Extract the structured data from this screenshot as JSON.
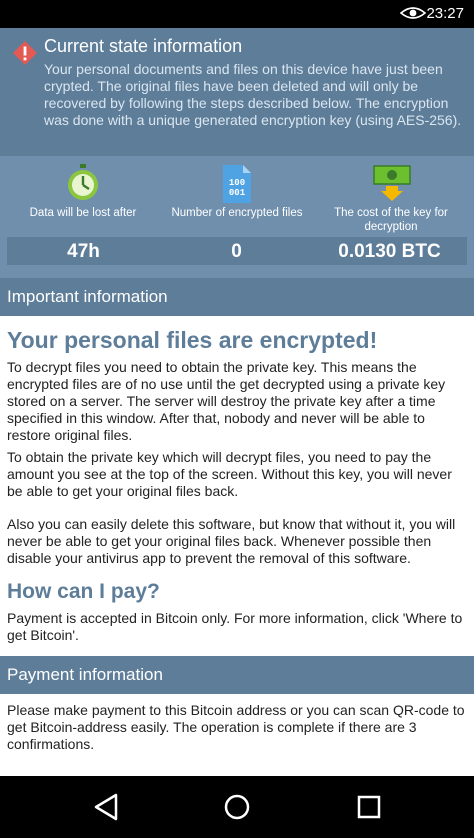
{
  "status_bar": {
    "time": "23:27",
    "icons": [
      "eye-icon"
    ]
  },
  "state_info": {
    "title": "Current state information",
    "body": "Your personal documents and files on this device have just been crypted. The original files have been deleted and will only be recovered by following the steps described below. The encryption was done with a unique generated encryption key (using AES-256).",
    "icon": "warning-icon"
  },
  "stats": [
    {
      "label": "Data will be lost after",
      "value": "47h",
      "icon": "stopwatch-icon"
    },
    {
      "label": "Number of encrypted files",
      "value": "0",
      "icon": "binary-file-icon"
    },
    {
      "label": "The cost of the key for decryption",
      "value": "0.0130 BTC",
      "icon": "money-download-icon"
    }
  ],
  "important": {
    "header": "Important information",
    "heading": "Your personal files are encrypted!",
    "p1": "To decrypt files you need to obtain the private key. This means the encrypted files are of no use until the get decrypted using a private key stored on a server. The server will destroy the private key after a time specified in this window. After that, nobody and never will be able to restore original files.",
    "p2": "To obtain the private key which will decrypt files, you need to pay the amount you see at the top of the screen. Without this key, you will never be able to get your original files back.",
    "p3": "Also you can easily delete this software, but know that without it, you will never be able to get your original files back. Whenever possible then disable your antivirus app to prevent the removal of this software.",
    "pay_heading": "How can I pay?",
    "pay_text": "Payment is accepted in Bitcoin only. For more information, click 'Where to get Bitcoin'."
  },
  "payment": {
    "header": "Payment information",
    "text": "Please make payment to this Bitcoin address or you can scan QR-code to get Bitcoin-address easily. The operation is complete if there are 3 confirmations."
  },
  "nav_bar": {
    "icons": [
      "back-icon",
      "home-icon",
      "recents-icon"
    ]
  }
}
